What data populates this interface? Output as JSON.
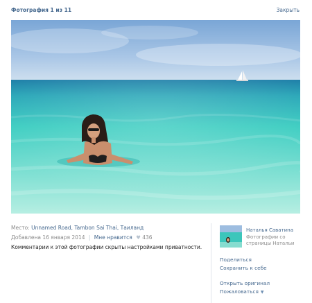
{
  "header": {
    "title": "Фотография 1 из 11",
    "close_label": "Закрыть"
  },
  "photo": {
    "alt_subject": "woman-in-sea"
  },
  "meta": {
    "place_label": "Место:",
    "place_value": "Unnamed Road, Tambon Sai Thai, Таиланд",
    "added_label": "Добавлена 16 января 2014",
    "separator": "|",
    "like_label": "Мне нравится",
    "like_icon": "heart-icon",
    "like_count": "436",
    "comment_notice": "Комментарии к этой фотографии скрыты настройками приватности."
  },
  "owner": {
    "name": "Наталья Саватина",
    "album_line1": "Фотографии со",
    "album_line2": "страницы Натальи"
  },
  "actions": {
    "share": "Поделиться",
    "save": "Сохранить к себе",
    "open_original": "Открыть оригинал",
    "report": "Пожаловаться"
  },
  "colors": {
    "link": "#45688e",
    "grey_text": "#8a8a8a",
    "divider": "#dfe4ea",
    "sky": "#8fb3da",
    "sea": "#2fc9bd"
  }
}
